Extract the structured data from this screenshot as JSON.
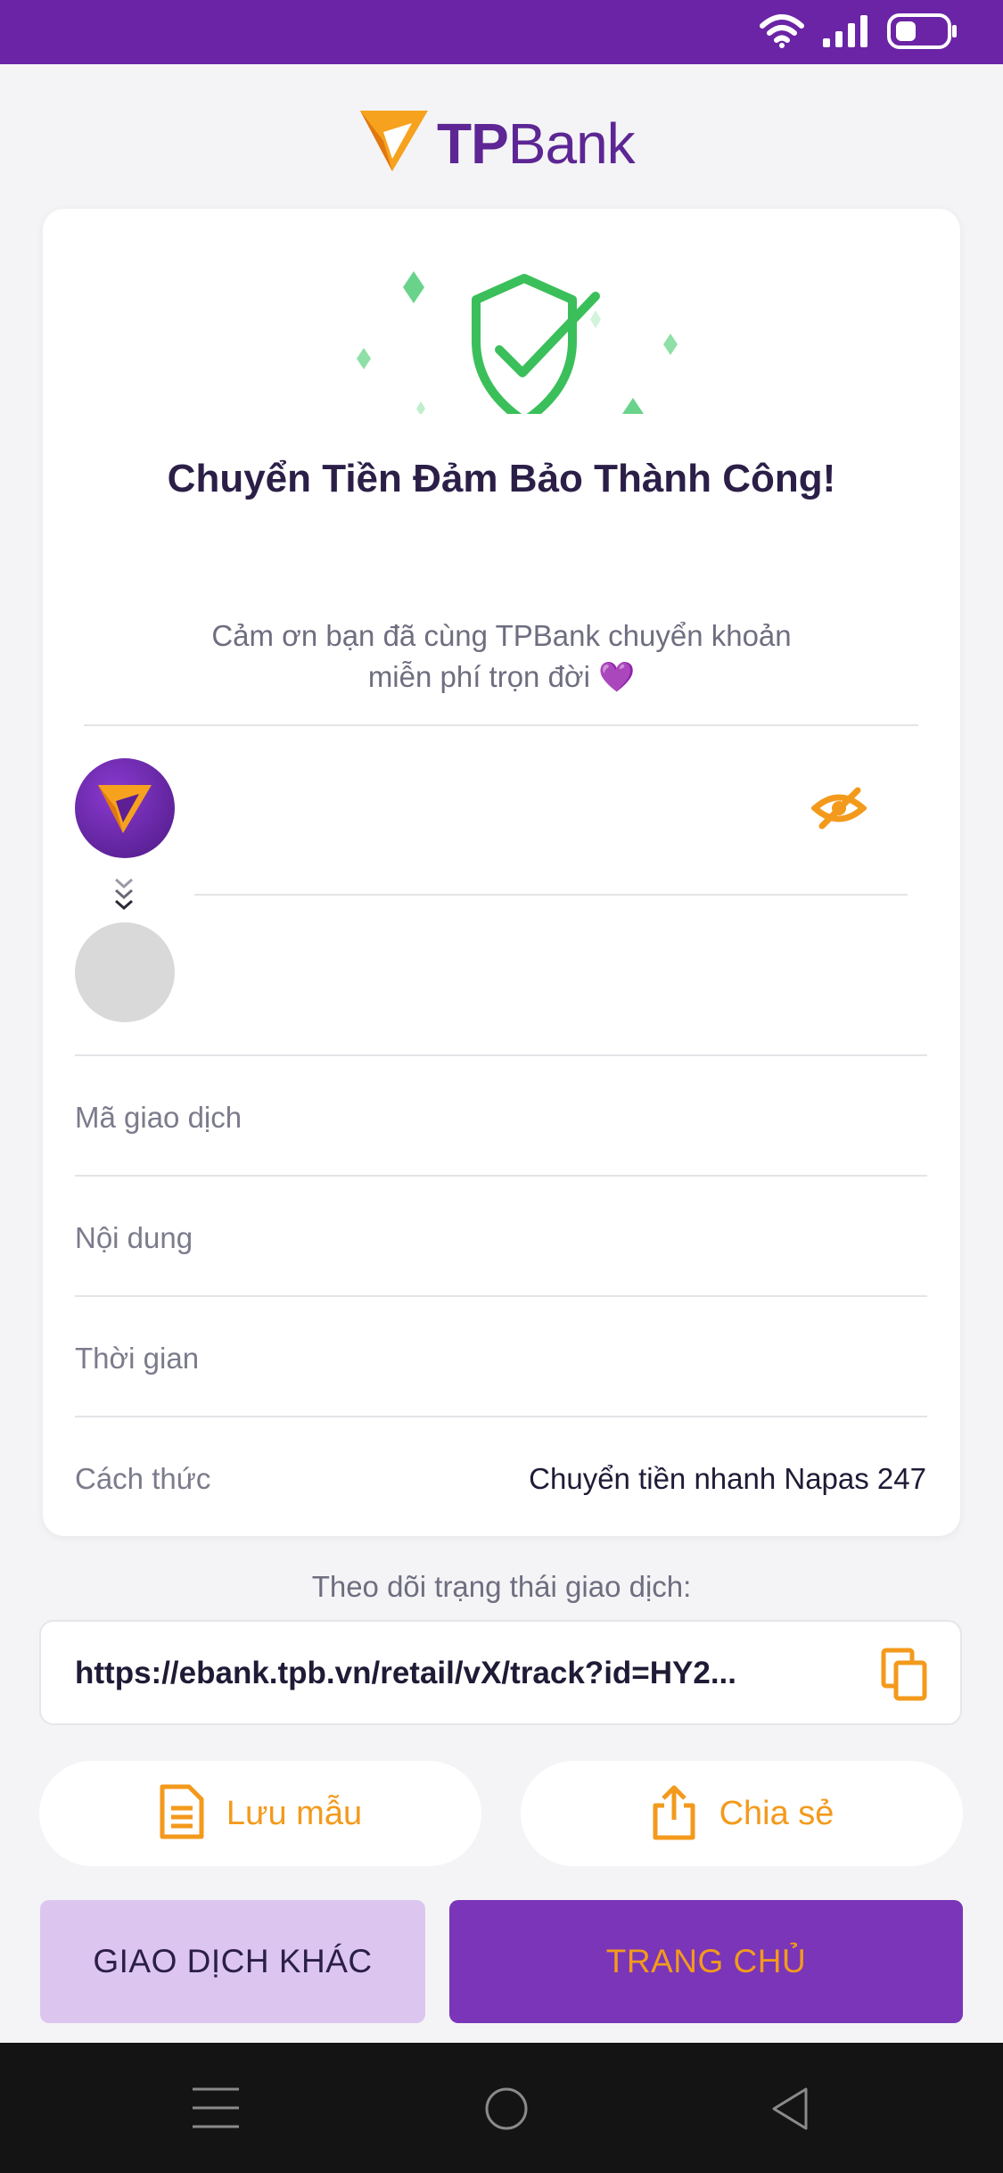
{
  "brand": {
    "logo_tp": "TP",
    "logo_bank": "Bank"
  },
  "result": {
    "title": "Chuyển Tiền Đảm Bảo Thành Công!",
    "thanks_line1": "Cảm ơn bạn đã cùng TPBank chuyển khoản",
    "thanks_line2": "miễn phí trọn đời 💜"
  },
  "details": {
    "transaction_id_label": "Mã giao dịch",
    "content_label": "Nội dung",
    "time_label": "Thời gian",
    "method_label": "Cách thức",
    "method_value": "Chuyển tiền nhanh Napas 247"
  },
  "tracking": {
    "label": "Theo dõi trạng thái giao dịch:",
    "url": "https://ebank.tpb.vn/retail/vX/track?id=HY2..."
  },
  "actions": {
    "save_template": "Lưu mẫu",
    "share": "Chia sẻ",
    "other_transaction": "GIAO DỊCH KHÁC",
    "home": "TRANG CHỦ"
  },
  "colors": {
    "brand_purple": "#6a24a5",
    "accent_orange": "#f39a1c",
    "success_green": "#3bbf5a"
  },
  "icons": [
    "wifi-icon",
    "signal-icon",
    "battery-icon",
    "shield-check-icon",
    "eye-off-icon",
    "chevrons-down-icon",
    "copy-icon",
    "document-icon",
    "share-icon",
    "menu-icon",
    "home-circle-icon",
    "back-icon"
  ]
}
